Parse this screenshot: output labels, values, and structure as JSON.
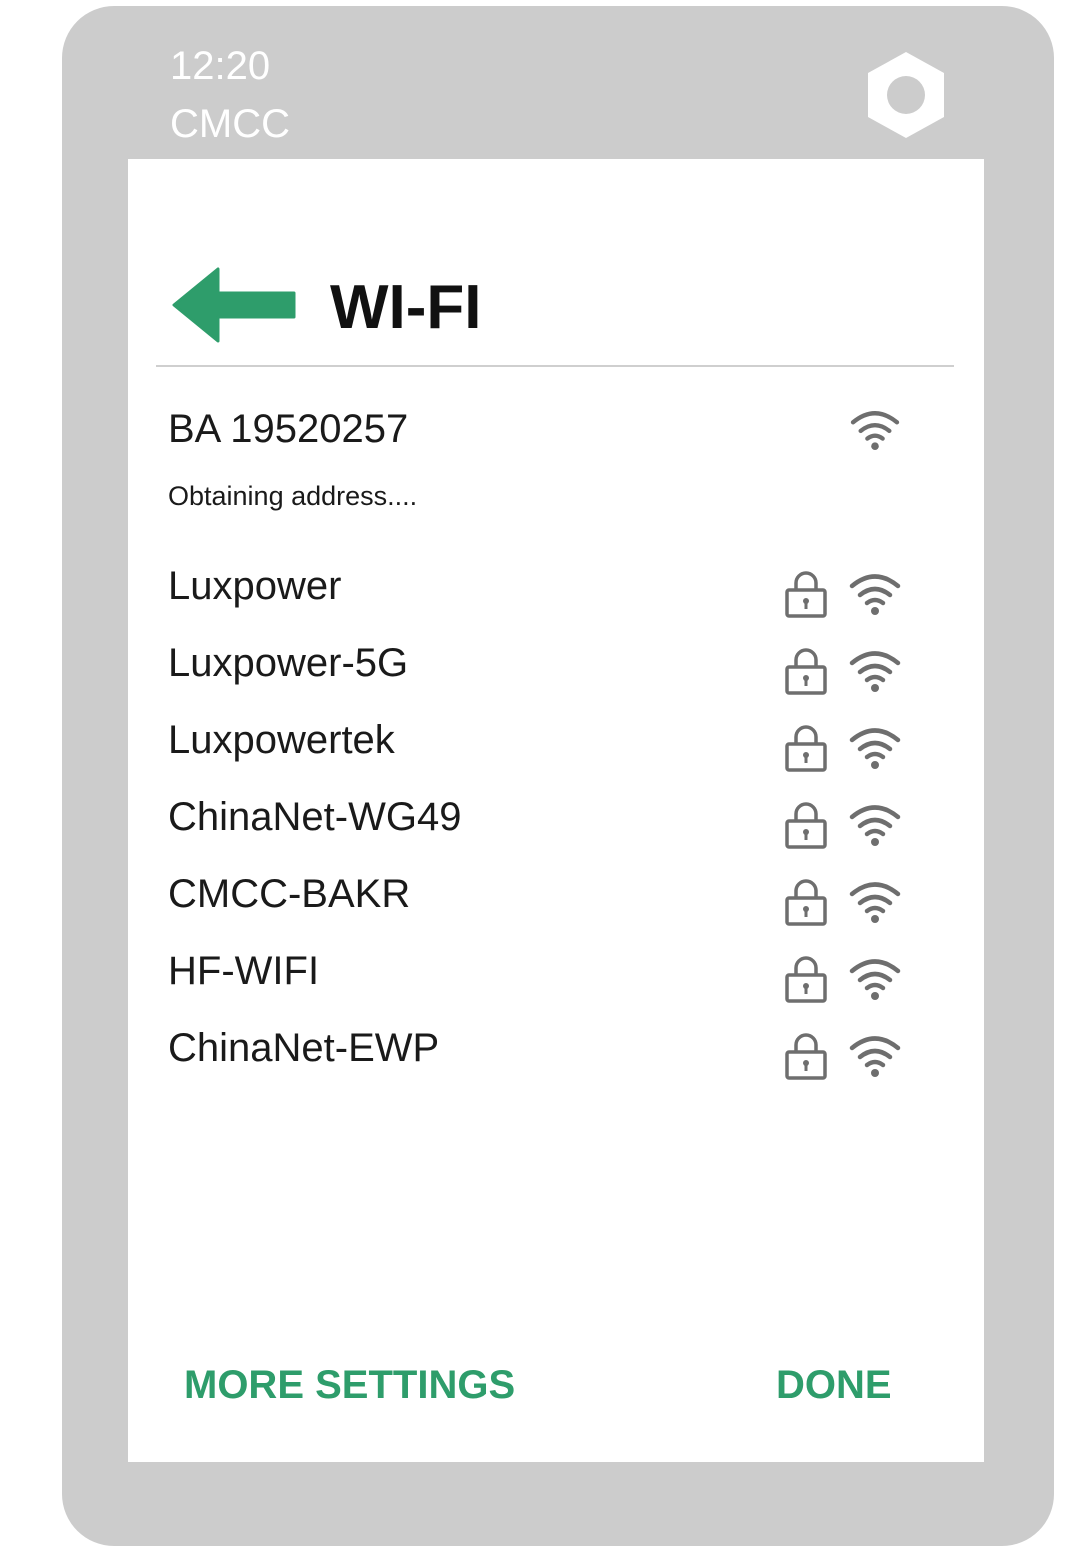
{
  "status_bar": {
    "time": "12:20",
    "carrier": "CMCC",
    "right_icon": "hexagon-icon"
  },
  "header": {
    "back_icon": "arrow-left-icon",
    "title": "WI-FI"
  },
  "current_network": {
    "name": "BA 19520257",
    "status": "Obtaining address....",
    "signal_icon": "wifi-icon"
  },
  "networks": [
    {
      "name": "Luxpower",
      "secured": true
    },
    {
      "name": "Luxpower-5G",
      "secured": true
    },
    {
      "name": "Luxpowertek",
      "secured": true
    },
    {
      "name": "ChinaNet-WG49",
      "secured": true
    },
    {
      "name": "CMCC-BAKR",
      "secured": true
    },
    {
      "name": "HF-WIFI",
      "secured": true
    },
    {
      "name": "ChinaNet-EWP",
      "secured": true
    }
  ],
  "footer": {
    "more_settings_label": "MORE SETTINGS",
    "done_label": "DONE"
  },
  "colors": {
    "accent": "#2e9d6b",
    "device_frame": "#cccccc",
    "icon_gray": "#6e6e6e"
  }
}
